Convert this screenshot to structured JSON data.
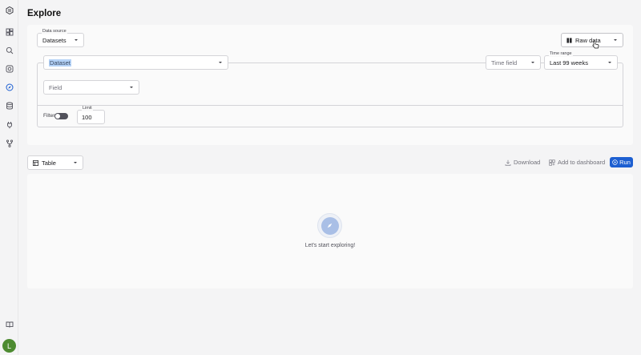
{
  "page": {
    "title": "Explore"
  },
  "sidebar": {
    "items": [
      {
        "icon": "logo-icon"
      },
      {
        "icon": "dashboard-icon"
      },
      {
        "icon": "search-icon"
      },
      {
        "icon": "camera-icon"
      },
      {
        "icon": "explore-compass-icon"
      },
      {
        "icon": "database-icon"
      },
      {
        "icon": "plug-icon"
      },
      {
        "icon": "branch-icon"
      }
    ],
    "bottom_icon": "book-icon",
    "avatar_initial": "L"
  },
  "query": {
    "data_source": {
      "label": "Data source",
      "value": "Datasets"
    },
    "view_mode": {
      "value": "Raw data"
    },
    "dataset": {
      "placeholder": "Dataset"
    },
    "time_field": {
      "placeholder": "Time field"
    },
    "time_range": {
      "label": "Time range",
      "value": "Last 99 weeks"
    },
    "field": {
      "placeholder": "Field"
    },
    "filter": {
      "label": "Filter",
      "enabled": false
    },
    "limit": {
      "label": "Limit",
      "value": "100"
    }
  },
  "results": {
    "view": {
      "value": "Table"
    },
    "download_label": "Download",
    "add_dashboard_label": "Add to dashboard",
    "run_label": "Run",
    "empty_message": "Let's start exploring!"
  },
  "colors": {
    "accent": "#1d5fd1",
    "avatar": "#4d8b31"
  }
}
